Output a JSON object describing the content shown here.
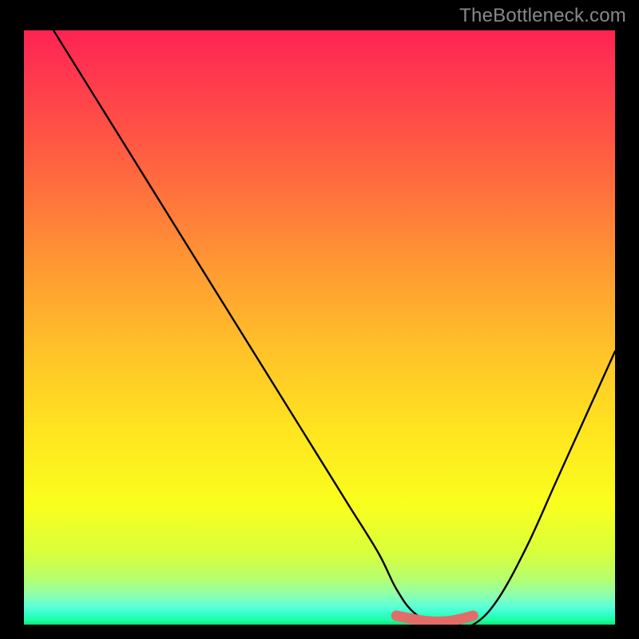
{
  "watermark": "TheBottleneck.com",
  "chart_data": {
    "type": "line",
    "title": "",
    "xlabel": "",
    "ylabel": "",
    "xlim": [
      0,
      100
    ],
    "ylim": [
      0,
      100
    ],
    "grid": false,
    "legend": false,
    "series": [
      {
        "name": "bottleneck-curve",
        "x": [
          5,
          10,
          15,
          20,
          25,
          30,
          35,
          40,
          45,
          50,
          55,
          60,
          63,
          66,
          70,
          73,
          76,
          80,
          85,
          90,
          95,
          100
        ],
        "values": [
          100,
          92,
          84,
          76,
          68,
          60,
          52,
          44,
          36,
          28,
          20,
          12,
          6,
          2,
          0,
          0,
          0,
          4,
          13,
          24,
          35,
          46
        ]
      }
    ],
    "highlight": {
      "name": "optimal-range",
      "x": [
        63,
        68,
        72,
        76
      ],
      "values": [
        1.5,
        0.6,
        0.6,
        1.5
      ]
    },
    "gradient_stops": [
      {
        "pos": 0,
        "color": "#ff2353"
      },
      {
        "pos": 0.5,
        "color": "#ffc528"
      },
      {
        "pos": 0.8,
        "color": "#f9ff1e"
      },
      {
        "pos": 1.0,
        "color": "#14df76"
      }
    ]
  }
}
